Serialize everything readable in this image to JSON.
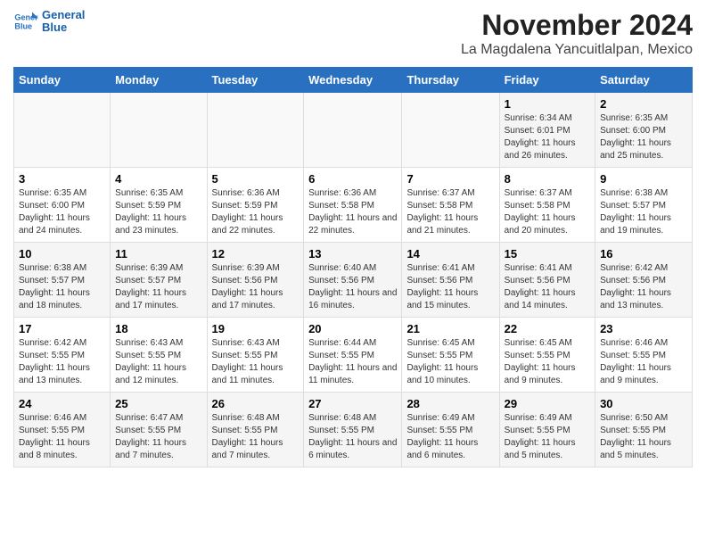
{
  "header": {
    "logo_line1": "General",
    "logo_line2": "Blue",
    "month_year": "November 2024",
    "location": "La Magdalena Yancuitlalpan, Mexico"
  },
  "days_of_week": [
    "Sunday",
    "Monday",
    "Tuesday",
    "Wednesday",
    "Thursday",
    "Friday",
    "Saturday"
  ],
  "weeks": [
    [
      {
        "day": "",
        "info": ""
      },
      {
        "day": "",
        "info": ""
      },
      {
        "day": "",
        "info": ""
      },
      {
        "day": "",
        "info": ""
      },
      {
        "day": "",
        "info": ""
      },
      {
        "day": "1",
        "info": "Sunrise: 6:34 AM\nSunset: 6:01 PM\nDaylight: 11 hours and 26 minutes."
      },
      {
        "day": "2",
        "info": "Sunrise: 6:35 AM\nSunset: 6:00 PM\nDaylight: 11 hours and 25 minutes."
      }
    ],
    [
      {
        "day": "3",
        "info": "Sunrise: 6:35 AM\nSunset: 6:00 PM\nDaylight: 11 hours and 24 minutes."
      },
      {
        "day": "4",
        "info": "Sunrise: 6:35 AM\nSunset: 5:59 PM\nDaylight: 11 hours and 23 minutes."
      },
      {
        "day": "5",
        "info": "Sunrise: 6:36 AM\nSunset: 5:59 PM\nDaylight: 11 hours and 22 minutes."
      },
      {
        "day": "6",
        "info": "Sunrise: 6:36 AM\nSunset: 5:58 PM\nDaylight: 11 hours and 22 minutes."
      },
      {
        "day": "7",
        "info": "Sunrise: 6:37 AM\nSunset: 5:58 PM\nDaylight: 11 hours and 21 minutes."
      },
      {
        "day": "8",
        "info": "Sunrise: 6:37 AM\nSunset: 5:58 PM\nDaylight: 11 hours and 20 minutes."
      },
      {
        "day": "9",
        "info": "Sunrise: 6:38 AM\nSunset: 5:57 PM\nDaylight: 11 hours and 19 minutes."
      }
    ],
    [
      {
        "day": "10",
        "info": "Sunrise: 6:38 AM\nSunset: 5:57 PM\nDaylight: 11 hours and 18 minutes."
      },
      {
        "day": "11",
        "info": "Sunrise: 6:39 AM\nSunset: 5:57 PM\nDaylight: 11 hours and 17 minutes."
      },
      {
        "day": "12",
        "info": "Sunrise: 6:39 AM\nSunset: 5:56 PM\nDaylight: 11 hours and 17 minutes."
      },
      {
        "day": "13",
        "info": "Sunrise: 6:40 AM\nSunset: 5:56 PM\nDaylight: 11 hours and 16 minutes."
      },
      {
        "day": "14",
        "info": "Sunrise: 6:41 AM\nSunset: 5:56 PM\nDaylight: 11 hours and 15 minutes."
      },
      {
        "day": "15",
        "info": "Sunrise: 6:41 AM\nSunset: 5:56 PM\nDaylight: 11 hours and 14 minutes."
      },
      {
        "day": "16",
        "info": "Sunrise: 6:42 AM\nSunset: 5:56 PM\nDaylight: 11 hours and 13 minutes."
      }
    ],
    [
      {
        "day": "17",
        "info": "Sunrise: 6:42 AM\nSunset: 5:55 PM\nDaylight: 11 hours and 13 minutes."
      },
      {
        "day": "18",
        "info": "Sunrise: 6:43 AM\nSunset: 5:55 PM\nDaylight: 11 hours and 12 minutes."
      },
      {
        "day": "19",
        "info": "Sunrise: 6:43 AM\nSunset: 5:55 PM\nDaylight: 11 hours and 11 minutes."
      },
      {
        "day": "20",
        "info": "Sunrise: 6:44 AM\nSunset: 5:55 PM\nDaylight: 11 hours and 11 minutes."
      },
      {
        "day": "21",
        "info": "Sunrise: 6:45 AM\nSunset: 5:55 PM\nDaylight: 11 hours and 10 minutes."
      },
      {
        "day": "22",
        "info": "Sunrise: 6:45 AM\nSunset: 5:55 PM\nDaylight: 11 hours and 9 minutes."
      },
      {
        "day": "23",
        "info": "Sunrise: 6:46 AM\nSunset: 5:55 PM\nDaylight: 11 hours and 9 minutes."
      }
    ],
    [
      {
        "day": "24",
        "info": "Sunrise: 6:46 AM\nSunset: 5:55 PM\nDaylight: 11 hours and 8 minutes."
      },
      {
        "day": "25",
        "info": "Sunrise: 6:47 AM\nSunset: 5:55 PM\nDaylight: 11 hours and 7 minutes."
      },
      {
        "day": "26",
        "info": "Sunrise: 6:48 AM\nSunset: 5:55 PM\nDaylight: 11 hours and 7 minutes."
      },
      {
        "day": "27",
        "info": "Sunrise: 6:48 AM\nSunset: 5:55 PM\nDaylight: 11 hours and 6 minutes."
      },
      {
        "day": "28",
        "info": "Sunrise: 6:49 AM\nSunset: 5:55 PM\nDaylight: 11 hours and 6 minutes."
      },
      {
        "day": "29",
        "info": "Sunrise: 6:49 AM\nSunset: 5:55 PM\nDaylight: 11 hours and 5 minutes."
      },
      {
        "day": "30",
        "info": "Sunrise: 6:50 AM\nSunset: 5:55 PM\nDaylight: 11 hours and 5 minutes."
      }
    ]
  ]
}
